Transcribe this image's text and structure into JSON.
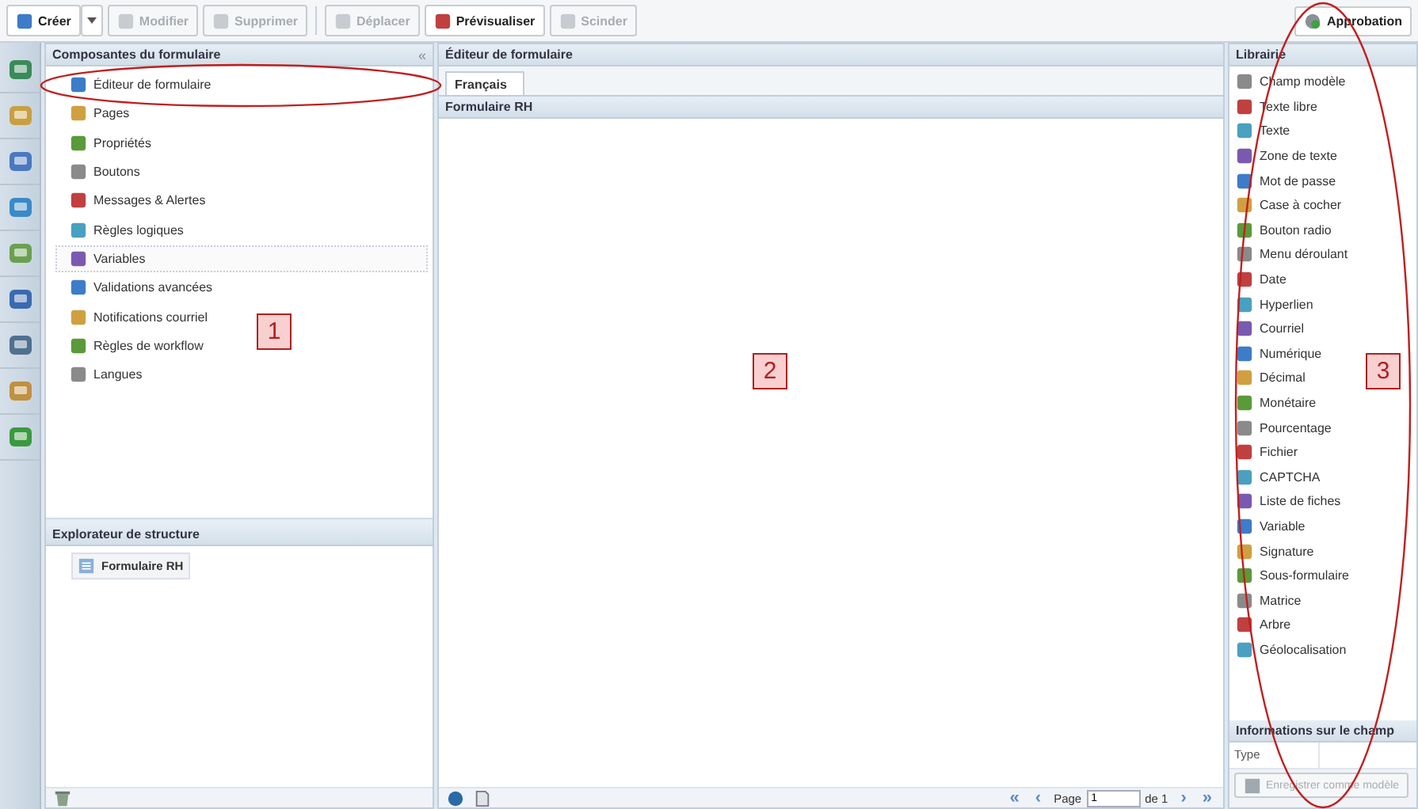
{
  "toolbar": {
    "buttons": [
      {
        "label": "Créer",
        "disabled": false,
        "dropdown": true
      },
      {
        "label": "Modifier",
        "disabled": true,
        "dropdown": false
      },
      {
        "label": "Supprimer",
        "disabled": true,
        "dropdown": false
      },
      {
        "label": "Déplacer",
        "disabled": true,
        "dropdown": false
      },
      {
        "label": "Prévisualiser",
        "disabled": false,
        "dropdown": false
      },
      {
        "label": "Scinder",
        "disabled": true,
        "dropdown": false
      }
    ],
    "right_button": {
      "label": "Approbation"
    }
  },
  "components_panel": {
    "title": "Composantes du formulaire",
    "collapse": "«",
    "items": [
      {
        "label": "Éditeur de formulaire",
        "selected": false
      },
      {
        "label": "Pages",
        "selected": false
      },
      {
        "label": "Propriétés",
        "selected": false
      },
      {
        "label": "Boutons",
        "selected": false
      },
      {
        "label": "Messages & Alertes",
        "selected": false
      },
      {
        "label": "Règles logiques",
        "selected": false
      },
      {
        "label": "Variables",
        "selected": true
      },
      {
        "label": "Validations avancées",
        "selected": false
      },
      {
        "label": "Notifications courriel",
        "selected": false
      },
      {
        "label": "Règles de workflow",
        "selected": false
      },
      {
        "label": "Langues",
        "selected": false
      }
    ]
  },
  "structure_panel": {
    "title": "Explorateur de structure",
    "tree": [
      {
        "label": "Formulaire RH"
      }
    ]
  },
  "editor": {
    "title": "Éditeur de formulaire",
    "tabs": [
      {
        "label": "Français",
        "selected": true
      }
    ],
    "form_title": "Formulaire RH",
    "pager": {
      "first": "«",
      "prev": "‹",
      "page_label": "Page",
      "page_value": "1",
      "of_label": "de 1",
      "next": "›",
      "last": "»"
    }
  },
  "library": {
    "title": "Librairie",
    "items": [
      "Champ modèle",
      "Texte libre",
      "Texte",
      "Zone de texte",
      "Mot de passe",
      "Case à cocher",
      "Bouton radio",
      "Menu déroulant",
      "Date",
      "Hyperlien",
      "Courriel",
      "Numérique",
      "Décimal",
      "Monétaire",
      "Pourcentage",
      "Fichier",
      "CAPTCHA",
      "Liste de fiches",
      "Variable",
      "Signature",
      "Sous-formulaire",
      "Matrice",
      "Arbre",
      "Géolocalisation"
    ]
  },
  "field_info": {
    "title": "Informations sur le champ",
    "type_label": "Type",
    "save_button": {
      "label": "Enregistrer comme modèle",
      "disabled": true
    }
  },
  "annotations": [
    {
      "label": "1"
    },
    {
      "label": "2"
    },
    {
      "label": "3"
    }
  ]
}
